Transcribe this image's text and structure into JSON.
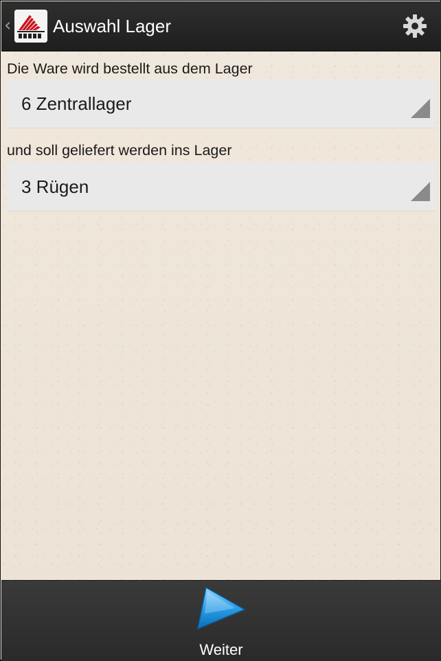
{
  "action_bar": {
    "title": "Auswahl Lager",
    "up_caret": "‹",
    "logo_icon": "app-logo-icon",
    "settings_icon": "gear-icon"
  },
  "order": {
    "from_label": "Die Ware wird bestellt aus dem Lager",
    "from_value": "6 Zentrallager",
    "to_label": "und soll geliefert werden ins Lager",
    "to_value": "3 Rügen"
  },
  "bottom_bar": {
    "next_label": "Weiter",
    "next_icon": "play-triangle-icon"
  },
  "colors": {
    "action_bar_bg": "#262626",
    "background": "#efe6da",
    "spinner_bg": "#e9e9e9",
    "next_icon_blue": "#2a9de6",
    "logo_red": "#c8141c"
  }
}
